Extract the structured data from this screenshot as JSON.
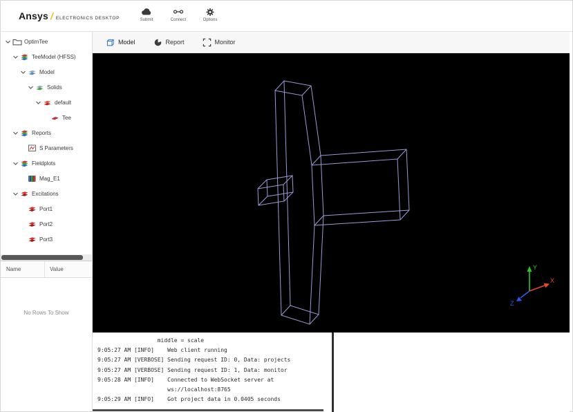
{
  "header": {
    "brand": "Ansys",
    "brand_slash": "/",
    "brand_sub": "ELECTRONICS DESKTOP",
    "toolbar": [
      {
        "label": "Submit",
        "icon": "cloud"
      },
      {
        "label": "Connect",
        "icon": "connect"
      },
      {
        "label": "Options",
        "icon": "gear"
      }
    ]
  },
  "tree": {
    "items": [
      {
        "label": "OptimTee",
        "level": 0,
        "icon": "folder",
        "expandable": true
      },
      {
        "label": "TeeModel (HFSS)",
        "level": 1,
        "icon": "hfss",
        "expandable": true
      },
      {
        "label": "Model",
        "level": 2,
        "icon": "model",
        "expandable": true
      },
      {
        "label": "Solids",
        "level": 3,
        "icon": "solids",
        "expandable": true
      },
      {
        "label": "default",
        "level": 4,
        "icon": "material",
        "expandable": true
      },
      {
        "label": "Tee",
        "level": 5,
        "icon": "part",
        "expandable": false
      },
      {
        "label": "Reports",
        "level": 1,
        "icon": "reports",
        "expandable": true
      },
      {
        "label": "S Parameters",
        "level": 2,
        "icon": "sparams",
        "expandable": false
      },
      {
        "label": "Fieldplots",
        "level": 1,
        "icon": "fieldplots",
        "expandable": true
      },
      {
        "label": "Mag_E1",
        "level": 2,
        "icon": "fieldplot",
        "expandable": false
      },
      {
        "label": "Excitations",
        "level": 1,
        "icon": "excitations",
        "expandable": true
      },
      {
        "label": "Port1",
        "level": 2,
        "icon": "port",
        "expandable": false
      },
      {
        "label": "Port2",
        "level": 2,
        "icon": "port",
        "expandable": false
      },
      {
        "label": "Port3",
        "level": 2,
        "icon": "port",
        "expandable": false
      }
    ]
  },
  "properties": {
    "columns": [
      "Name",
      "Value"
    ],
    "empty_text": "No Rows To Show"
  },
  "tabs": [
    {
      "label": "Model",
      "icon": "model-tab-icon",
      "active": true
    },
    {
      "label": "Report",
      "icon": "report-tab-icon",
      "active": false
    },
    {
      "label": "Monitor",
      "icon": "monitor-tab-icon",
      "active": false
    }
  ],
  "viewport": {
    "background": "#000000",
    "wire_color": "#9b9bd8",
    "axes": {
      "x": {
        "label": "X",
        "color": "#e8442e"
      },
      "y": {
        "label": "Y",
        "color": "#29c829"
      },
      "z": {
        "label": "Z",
        "color": "#3457e0"
      }
    }
  },
  "console": {
    "lines": [
      "                  middle = scale",
      "9:05:27 AM [INFO]    Web client running",
      "9:05:27 AM [VERBOSE] Sending request ID: 0, Data: projects",
      "9:05:27 AM [VERBOSE] Sending request ID: 1, Data: monitor",
      "9:05:28 AM [INFO]    Connected to WebSocket server at",
      "                     ws://localhost:8765",
      "9:05:29 AM [INFO]    Got project data in 0.0405 seconds"
    ]
  }
}
